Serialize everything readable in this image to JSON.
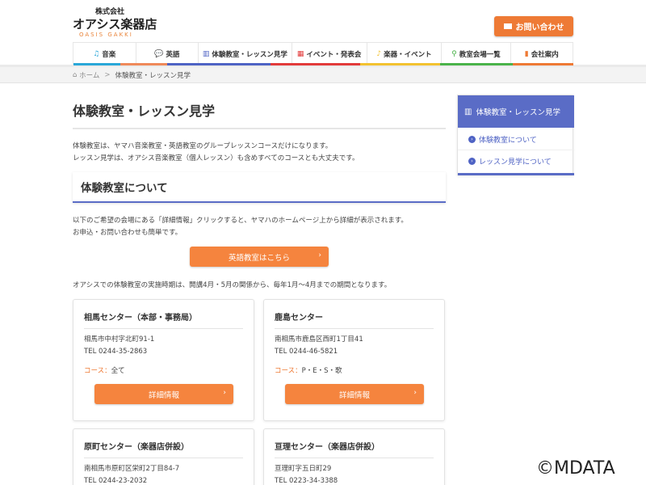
{
  "header": {
    "company_prefix": "株式会社",
    "company_name": "オアシス楽器店",
    "company_romaji": "OASIS GAKKI",
    "contact_button": "お問い合わせ"
  },
  "nav": [
    {
      "label": "音楽",
      "icon": "music-note-icon",
      "color": "#2aa7d8"
    },
    {
      "label": "英語",
      "icon": "speech-bubble-icon",
      "color": "#ef8a5a"
    },
    {
      "label": "体験教室・レッスン見学",
      "icon": "piano-icon",
      "color": "#4f63c4"
    },
    {
      "label": "イベント・発表会",
      "icon": "calendar-icon",
      "color": "#e23b3b"
    },
    {
      "label": "楽器・イベント",
      "icon": "saxophone-icon",
      "color": "#f2c230"
    },
    {
      "label": "教室会場一覧",
      "icon": "map-pin-icon",
      "color": "#4ab34a"
    },
    {
      "label": "会社案内",
      "icon": "building-icon",
      "color": "#ee7a35"
    }
  ],
  "breadcrumb": {
    "home": "ホーム",
    "separator": ">",
    "current": "体験教室・レッスン見学"
  },
  "main": {
    "title": "体験教室・レッスン見学",
    "intro_line1": "体験教室は、ヤマハ音楽教室・英語教室のグループレッスンコースだけになります。",
    "intro_line2": "レッスン見学は、オアシス音楽教室（個人レッスン）も含めすべてのコースとも大丈夫です。",
    "section_title": "体験教室について",
    "desc_line1": "以下のご希望の会場にある「詳細情報」クリックすると、ヤマハのホームページ上から詳細が表示されます。",
    "desc_line2": "お申込・お問い合わせも簡単です。",
    "english_button": "英語教室はこちら",
    "period": "オアシスでの体験教室の実施時期は、開講4月・5月の関係から、毎年1月〜4月までの期間となります。"
  },
  "cards": [
    {
      "title": "相馬センター（本部・事務局）",
      "address": "相馬市中村字北町91-1",
      "tel": "TEL 0244-35-2863",
      "course_label": "コース：",
      "course_value": "全て",
      "button": "詳細情報"
    },
    {
      "title": "鹿島センター",
      "address": "南相馬市鹿島区西町1丁目41",
      "tel": "TEL 0244-46-5821",
      "course_label": "コース：",
      "course_value": "P・E・S・歌",
      "button": "詳細情報"
    },
    {
      "title": "原町センター（楽器店併設）",
      "address": "南相馬市原町区栄町2丁目84-7",
      "tel": "TEL 0244-23-2032"
    },
    {
      "title": "亘理センター（楽器店併設）",
      "address": "亘理町字五日町29",
      "tel": "TEL 0223-34-3388"
    }
  ],
  "sidebar": {
    "title": "体験教室・レッスン見学",
    "items": [
      "体験教室について",
      "レッスン見学について"
    ]
  },
  "watermark": "©MDATA"
}
